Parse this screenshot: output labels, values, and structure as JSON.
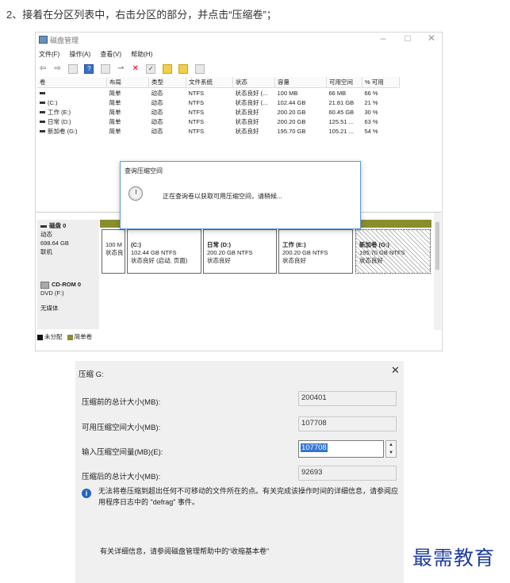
{
  "step_text": "2、接着在分区列表中，右击分区的部分，并点击“压缩卷”；",
  "disk_mgmt": {
    "title": "磁盘管理",
    "menu": [
      "文件(F)",
      "操作(A)",
      "查看(V)",
      "帮助(H)"
    ],
    "columns": [
      "卷",
      "布局",
      "类型",
      "文件系统",
      "状态",
      "容量",
      "可用空间",
      "% 可用"
    ],
    "rows": [
      [
        "",
        "简单",
        "动态",
        "NTFS",
        "状态良好 (...",
        "100 MB",
        "66 MB",
        "66 %"
      ],
      [
        "(C:)",
        "简单",
        "动态",
        "NTFS",
        "状态良好 (...",
        "102.44 GB",
        "21.81 GB",
        "21 %"
      ],
      [
        "工作 (E:)",
        "简单",
        "动态",
        "NTFS",
        "状态良好",
        "200.20 GB",
        "60.45 GB",
        "30 %"
      ],
      [
        "日常 (D:)",
        "简单",
        "动态",
        "NTFS",
        "状态良好",
        "200.20 GB",
        "125.51 ...",
        "63 %"
      ],
      [
        "新加卷 (G:)",
        "简单",
        "动态",
        "NTFS",
        "状态良好",
        "195.70 GB",
        "105.21 ...",
        "54 %"
      ]
    ],
    "disk0": {
      "name": "磁盘 0",
      "type": "动态",
      "size": "698.64 GB",
      "status": "联机"
    },
    "partitions": [
      {
        "name": "",
        "size": "100 M",
        "status": "状态良"
      },
      {
        "name": "(C:)",
        "size": "102.44 GB NTFS",
        "status": "状态良好 (启动, 页面)"
      },
      {
        "name": "日常 (D:)",
        "size": "200.20 GB NTFS",
        "status": "状态良好"
      },
      {
        "name": "工作 (E:)",
        "size": "200.20 GB NTFS",
        "status": "状态良好"
      },
      {
        "name": "新加卷 (G:)",
        "size": "195.70 GB NTFS",
        "status": "状态良好"
      }
    ],
    "cdrom": {
      "name": "CD-ROM 0",
      "drive": "DVD (F:)",
      "media": "无媒体"
    },
    "legend": [
      "未分配",
      "简单卷"
    ],
    "query_dialog": {
      "title": "查询压缩空间",
      "message": "正在查询卷以获取可用压缩空间，请稍候..."
    }
  },
  "shrink_dialog": {
    "title": "压缩 G:",
    "fields": [
      {
        "label": "压缩前的总计大小(MB):",
        "value": "200401"
      },
      {
        "label": "可用压缩空间大小(MB):",
        "value": "107708"
      },
      {
        "label": "输入压缩空间量(MB)(E):",
        "value": "107708"
      },
      {
        "label": "压缩后的总计大小(MB):",
        "value": "92693"
      }
    ],
    "info": "无法将卷压缩到超出任何不可移动的文件所在的点。有关完成该操作时间的详细信息，请参阅应用程序日志中的 \"defrag\" 事件。",
    "more": "有关详细信息，请参阅磁盘管理帮助中的“收缩基本卷”"
  },
  "watermark": "最需教育",
  "colors": {
    "simple_volume": "#8a8d2e",
    "primary": "#2c4caf",
    "info": "#2067c3",
    "selection": "#3374d6"
  }
}
